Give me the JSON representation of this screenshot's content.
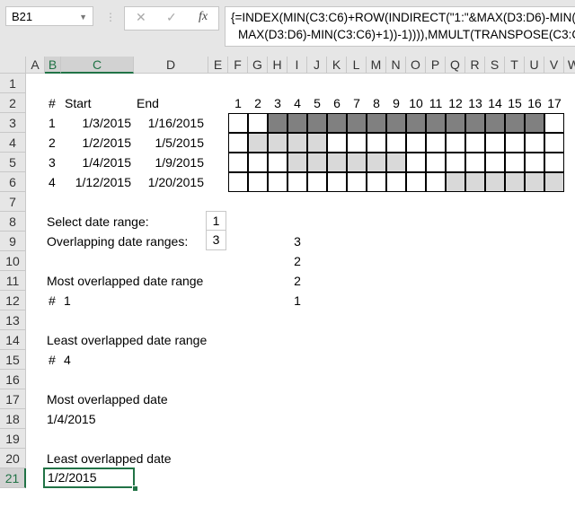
{
  "name_box": "B21",
  "formula_bar": {
    "line1": "{=INDEX(MIN(C3:C6)+ROW(INDIRECT(\"1:\"&MAX(D3:D6)-MIN(C3:C6)+1))-1,MATCH(MIN(",
    "line2": "MAX(D3:D6)-MIN(C3:C6)+1))-1)))),MMULT(TRANSPOSE(C3:C6)"
  },
  "formula_icons": [
    "close-icon",
    "check-icon",
    "fx-icon"
  ],
  "columns": [
    "A",
    "B",
    "C",
    "D",
    "E",
    "F",
    "G",
    "H",
    "I",
    "J",
    "K",
    "L",
    "M",
    "N",
    "O",
    "P",
    "Q",
    "R",
    "S",
    "T",
    "U",
    "V",
    "W"
  ],
  "rows": [
    "1",
    "2",
    "3",
    "4",
    "5",
    "6",
    "7",
    "8",
    "9",
    "10",
    "11",
    "12",
    "13",
    "14",
    "15",
    "16",
    "17",
    "18",
    "19",
    "20",
    "21"
  ],
  "table": {
    "headers": [
      "#",
      "Start",
      "End"
    ],
    "rows": [
      [
        "1",
        "1/3/2015",
        "1/16/2015"
      ],
      [
        "2",
        "1/2/2015",
        "1/5/2015"
      ],
      [
        "3",
        "1/4/2015",
        "1/9/2015"
      ],
      [
        "4",
        "1/12/2015",
        "1/20/2015"
      ]
    ]
  },
  "grid": {
    "day_labels": [
      "1",
      "2",
      "3",
      "4",
      "5",
      "6",
      "7",
      "8",
      "9",
      "10",
      "11",
      "12",
      "13",
      "14",
      "15",
      "16",
      "17"
    ],
    "fills": [
      [
        0,
        0,
        2,
        2,
        2,
        2,
        2,
        2,
        2,
        2,
        2,
        2,
        2,
        2,
        2,
        2,
        0
      ],
      [
        0,
        1,
        1,
        1,
        1,
        0,
        0,
        0,
        0,
        0,
        0,
        0,
        0,
        0,
        0,
        0,
        0
      ],
      [
        0,
        0,
        0,
        1,
        1,
        1,
        1,
        1,
        1,
        0,
        0,
        0,
        0,
        0,
        0,
        0,
        0
      ],
      [
        0,
        0,
        0,
        0,
        0,
        0,
        0,
        0,
        0,
        0,
        0,
        1,
        1,
        1,
        1,
        1,
        1
      ]
    ],
    "colors": {
      "selected": "#808080",
      "overlap": "#d9d9d9"
    }
  },
  "select_label": "Select date range:",
  "select_value": "1",
  "overlap_label": "Overlapping date ranges:",
  "overlap_value": "3",
  "overlap_counts": [
    "3",
    "2",
    "2",
    "1"
  ],
  "most_range_label": "Most overlapped date range",
  "most_range_hash": "#",
  "most_range_value": "1",
  "least_range_label": "Least overlapped date range",
  "least_range_hash": "#",
  "least_range_value": "4",
  "most_date_label": "Most overlapped date",
  "most_date_value": "1/4/2015",
  "least_date_label": "Least overlapped date",
  "least_date_value": "1/2/2015"
}
